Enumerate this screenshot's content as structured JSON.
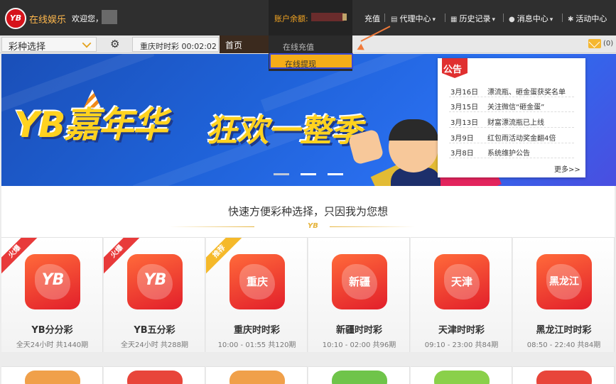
{
  "header": {
    "logo_text": "YB",
    "site_name": "在线娱乐",
    "welcome": "欢迎您，",
    "balance_label": "账户余额:",
    "nav": [
      {
        "label": "充值",
        "icon": ""
      },
      {
        "label": "代理中心",
        "icon": "▤"
      },
      {
        "label": "历史记录",
        "icon": "▦"
      },
      {
        "label": "消息中心",
        "icon": "●"
      },
      {
        "label": "活动中心",
        "icon": "✱"
      }
    ]
  },
  "account_menu": {
    "items": [
      "在线充值",
      "在线提现"
    ],
    "active_index": 1
  },
  "subbar": {
    "lottery_select_label": "彩种选择",
    "timer_label": "重庆时时彩 00:02:02",
    "home_label": "首页",
    "mail_count": "(0)"
  },
  "banner": {
    "title_main": "YB嘉年华",
    "title_sub": "狂欢一整季",
    "slide_count": 3,
    "active_slide": 2
  },
  "notice": {
    "title": "公告",
    "items": [
      {
        "date": "3月16日",
        "text": "漂流瓶、砸金蛋获奖名单"
      },
      {
        "date": "3月15日",
        "text": "关注微信“砸金蛋”"
      },
      {
        "date": "3月13日",
        "text": "财富漂流瓶已上线"
      },
      {
        "date": "3月9日",
        "text": "红包雨活动奖金翻4倍"
      },
      {
        "date": "3月8日",
        "text": "系统维护公告"
      }
    ],
    "more": "更多>>"
  },
  "section": {
    "title": "快速方便彩种选择，只因我为您想",
    "mark": "YB"
  },
  "lotteries": [
    {
      "name": "YB分分彩",
      "meta": "全天24小时 共1440期",
      "icon_text": "YB",
      "ribbon": "火爆",
      "ribbon_type": "hot"
    },
    {
      "name": "YB五分彩",
      "meta": "全天24小时 共288期",
      "icon_text": "YB",
      "ribbon": "火爆",
      "ribbon_type": "hot"
    },
    {
      "name": "重庆时时彩",
      "meta": "10:00 - 01:55 共120期",
      "icon_text": "重庆",
      "ribbon": "推荐",
      "ribbon_type": "rec"
    },
    {
      "name": "新疆时时彩",
      "meta": "10:10 - 02:00 共96期",
      "icon_text": "新疆",
      "ribbon": "",
      "ribbon_type": ""
    },
    {
      "name": "天津时时彩",
      "meta": "09:10 - 23:00 共84期",
      "icon_text": "天津",
      "ribbon": "",
      "ribbon_type": ""
    },
    {
      "name": "黑龙江时时彩",
      "meta": "08:50 - 22:40 共84期",
      "icon_text": "黑龙江",
      "ribbon": "",
      "ribbon_type": ""
    }
  ],
  "colors": {
    "topbar": "#2f2f2f",
    "accent_orange": "#f5ad17",
    "brand_red": "#e21f2b",
    "banner_blue": "#1f62d8"
  }
}
